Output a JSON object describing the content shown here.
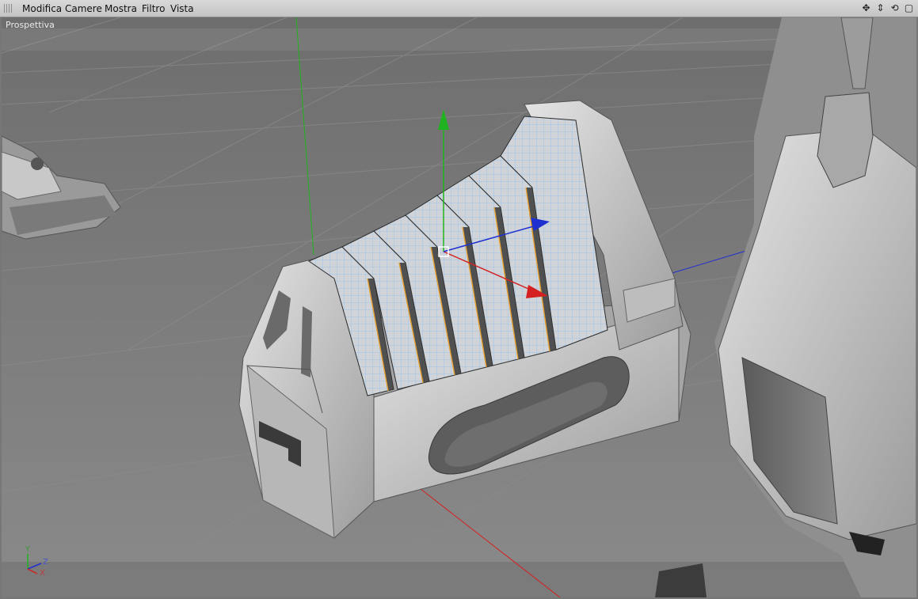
{
  "menubar": {
    "items": [
      "Modifica",
      "Camere",
      "Mostra",
      "Filtro",
      "Vista"
    ],
    "nav_icons": [
      "move-view-icon",
      "zoom-view-icon",
      "rotate-view-icon",
      "maximize-view-icon"
    ]
  },
  "viewport": {
    "label": "Prospettiva",
    "axis": {
      "y": "Y",
      "z": "Z",
      "x": "X"
    }
  },
  "colors": {
    "axis_x": "#d42020",
    "axis_y": "#1fb41f",
    "axis_z": "#2030d0",
    "wireframe": "#8fc0f0",
    "selection_edge": "#e6a030"
  }
}
